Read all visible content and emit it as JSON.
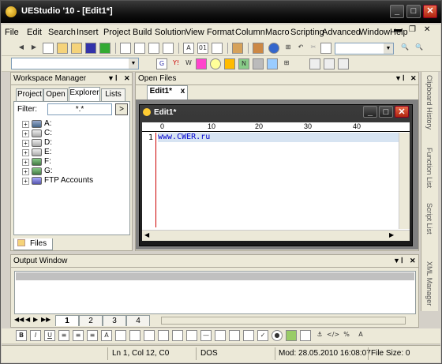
{
  "app": {
    "title": "UEStudio '10 - [Edit1*]"
  },
  "menu": [
    "File",
    "Edit",
    "Search",
    "Insert",
    "Project",
    "Build",
    "Solution",
    "View",
    "Format",
    "Column",
    "Macro",
    "Scripting",
    "Advanced",
    "Window",
    "Help"
  ],
  "workspace": {
    "title": "Workspace Manager",
    "tabs": [
      "Project",
      "Open",
      "Explorer",
      "Lists"
    ],
    "active_tab": "Explorer",
    "filter_label": "Filter:",
    "filter_value": "*.*",
    "go_button": ">",
    "drives": [
      "A:",
      "C:",
      "D:",
      "E:",
      "F:",
      "G:",
      "FTP Accounts"
    ],
    "bottom_tab": "Files"
  },
  "openfiles": {
    "title": "Open Files",
    "tab": "Edit1*",
    "close": "x"
  },
  "editor": {
    "title": "Edit1*",
    "ruler": [
      "0",
      "10",
      "20",
      "30",
      "40"
    ],
    "line_number": "1",
    "line_text": "www.CWER.ru"
  },
  "output": {
    "title": "Output Window",
    "tabs": [
      "1",
      "2",
      "3",
      "4"
    ]
  },
  "sidebar": [
    "Clipboard History",
    "Function List",
    "Script List",
    "XML Manager"
  ],
  "status": {
    "position": "Ln 1, Col 12, C0",
    "format": "DOS",
    "modified": "Mod: 28.05.2010 16:08:07",
    "filesize": "File Size: 0"
  }
}
